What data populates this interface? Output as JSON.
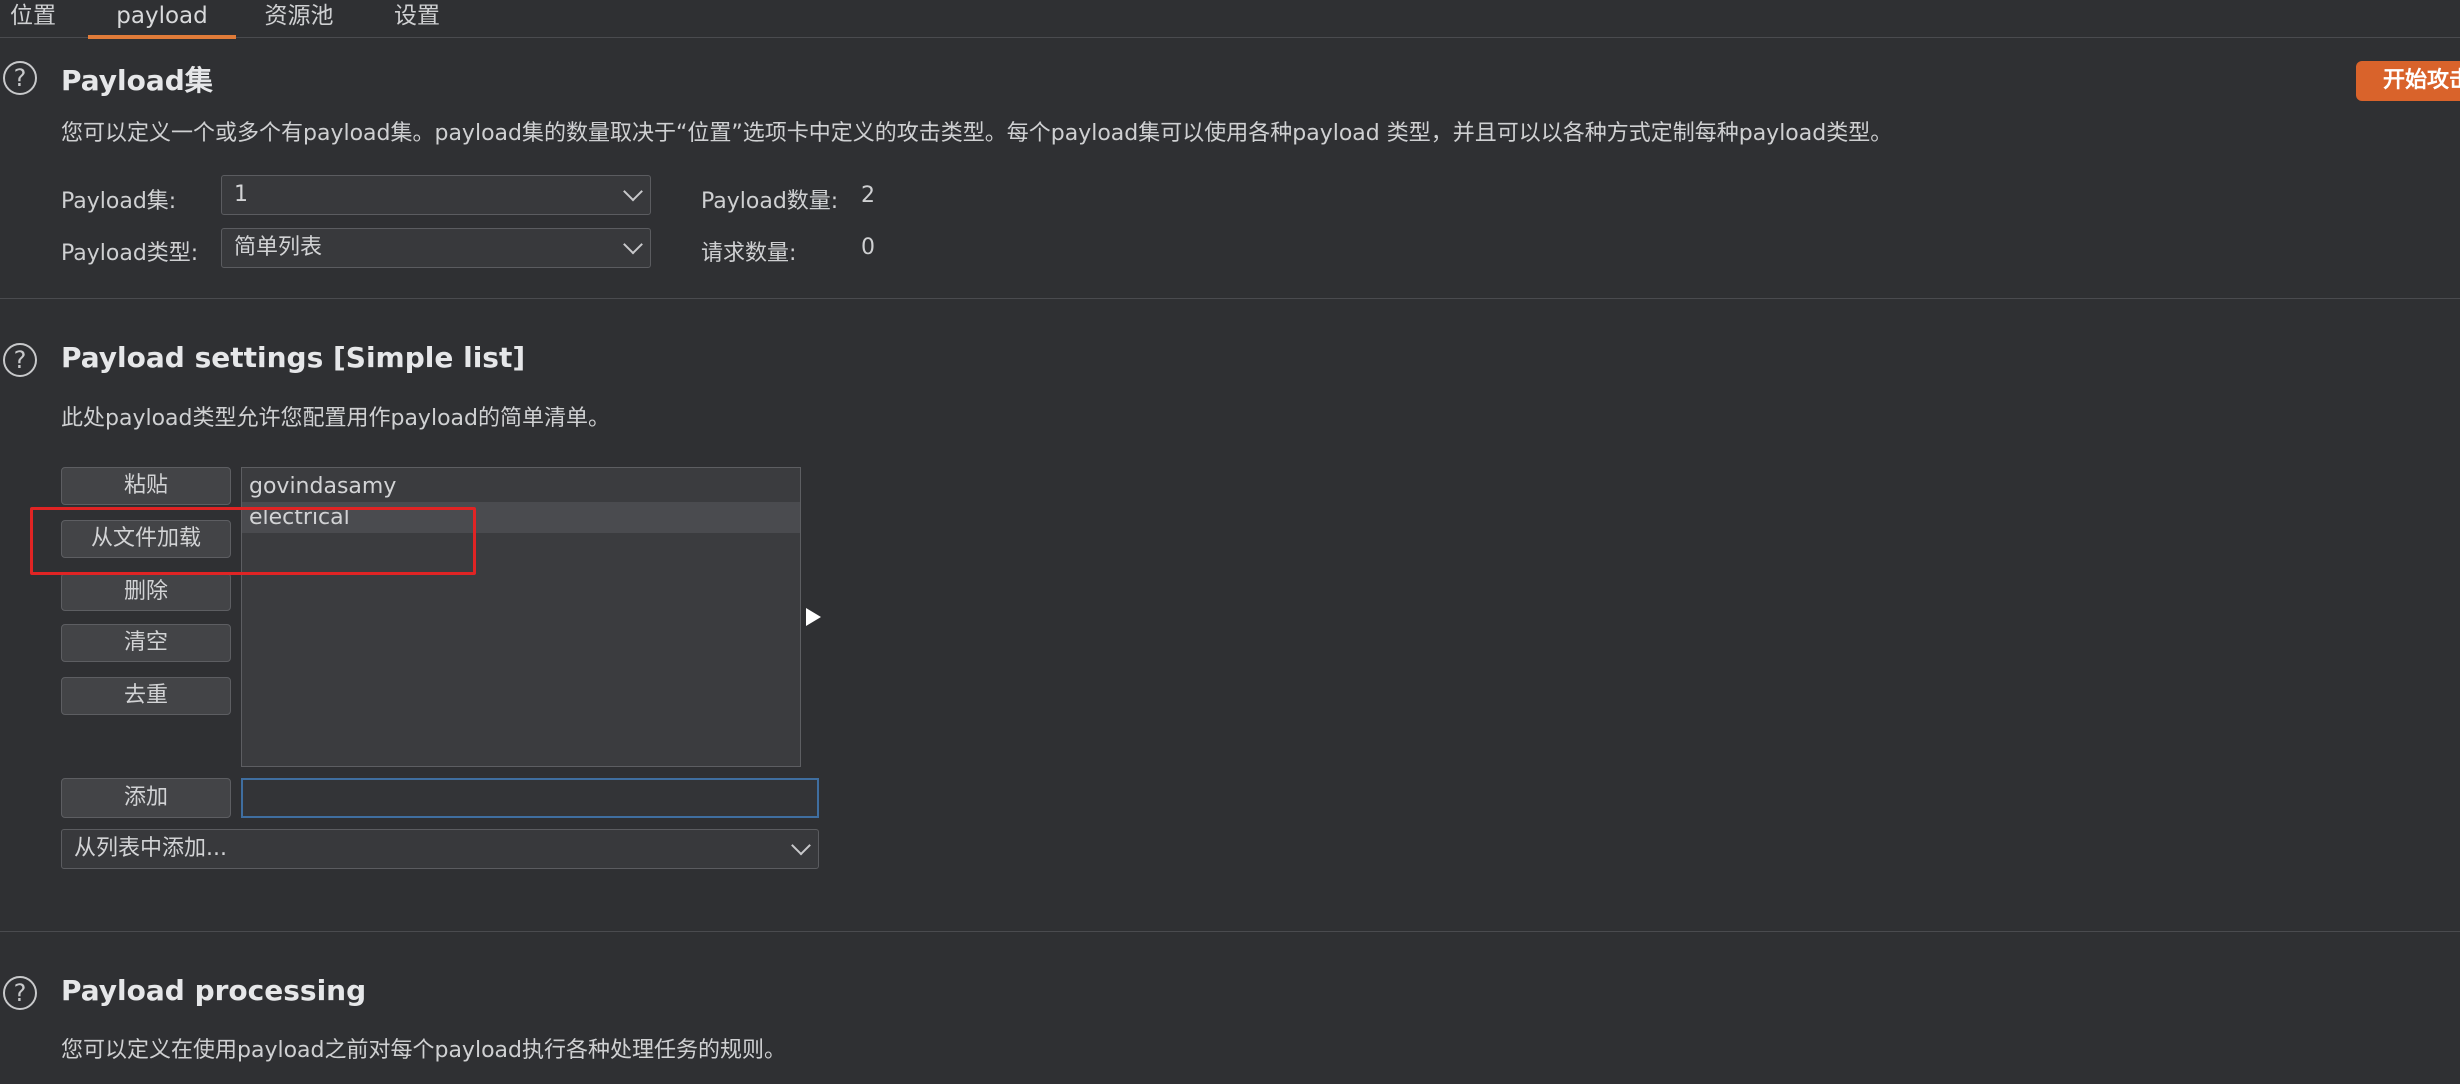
{
  "tabs": [
    {
      "label": "位置"
    },
    {
      "label": "payload"
    },
    {
      "label": "资源池"
    },
    {
      "label": "设置"
    }
  ],
  "start_attack_label": "开始攻击",
  "payload_sets": {
    "title": "Payload集",
    "description": "您可以定义一个或多个有payload集。payload集的数量取决于“位置”选项卡中定义的攻击类型。每个payload集可以使用各种payload 类型，并且可以以各种方式定制每种payload类型。",
    "set_label": "Payload集:",
    "set_value": "1",
    "type_label": "Payload类型:",
    "type_value": "简单列表",
    "count_label": "Payload数量:",
    "count_value": "2",
    "requests_label": "请求数量:",
    "requests_value": "0"
  },
  "payload_settings": {
    "title": "Payload settings [Simple list]",
    "description": "此处payload类型允许您配置用作payload的简单清单。",
    "buttons": {
      "paste": "粘贴",
      "load": "从文件加载",
      "remove": "删除",
      "clear": "清空",
      "dedupe": "去重",
      "add": "添加"
    },
    "items": [
      "govindasamy",
      "electrical"
    ],
    "add_input_value": "",
    "add_from_list": "从列表中添加..."
  },
  "payload_processing": {
    "title": "Payload processing",
    "description": "您可以定义在使用payload之前对每个payload执行各种处理任务的规则。"
  },
  "help_glyph": "?",
  "icons": {
    "help": "question-circle-icon",
    "dropdown": "chevron-down-icon",
    "expand": "triangle-right-icon"
  },
  "colors": {
    "accent": "#e07b39",
    "start_button": "#d9632b",
    "highlight_box": "#e02424",
    "input_focus": "#3f6ea0"
  }
}
